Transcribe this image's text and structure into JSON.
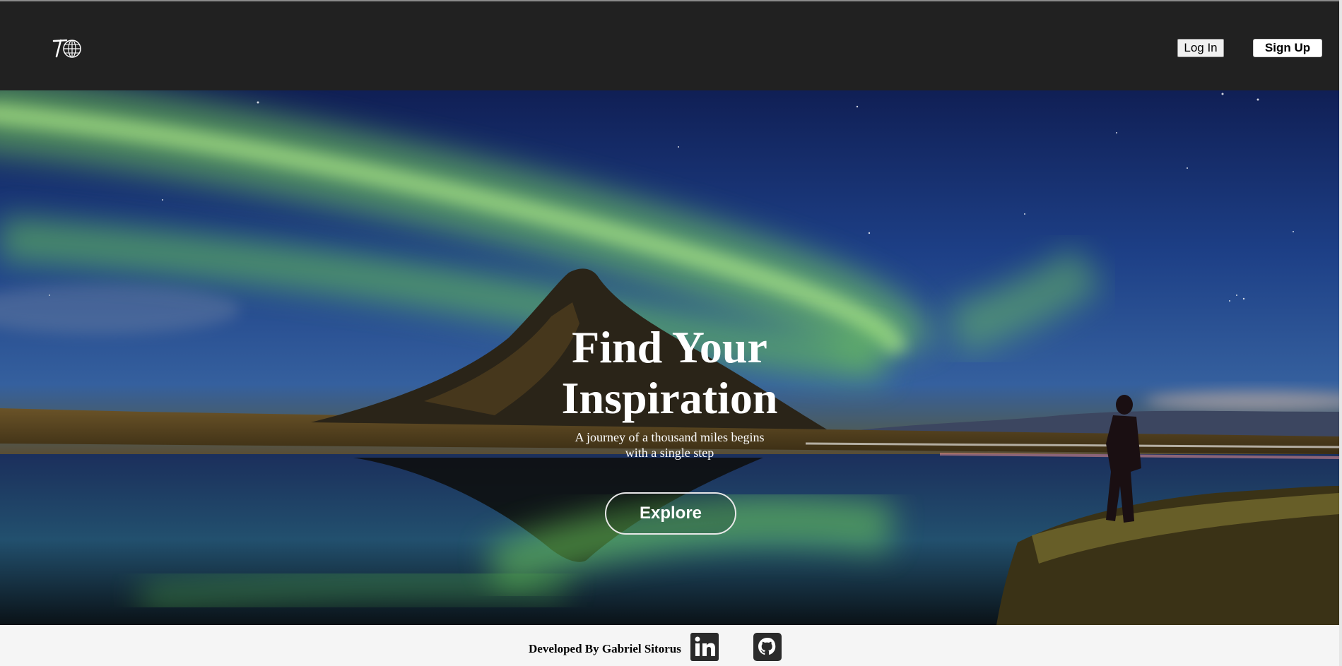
{
  "header": {
    "logo_icon": "travel-globe-logo-icon",
    "login_label": "Log In",
    "signup_label": "Sign Up"
  },
  "hero": {
    "background": "northern-lights-mountain-lake-photo",
    "title_line1": "Find Your",
    "title_line2": "Inspiration",
    "subtitle_line1": "A journey of a thousand miles begins",
    "subtitle_line2": "with a single step",
    "cta_label": "Explore"
  },
  "footer": {
    "credit": "Developed By Gabriel Sitorus",
    "social_icons": [
      "linkedin-icon",
      "github-icon"
    ]
  },
  "colors": {
    "navbar": "#212121",
    "footer": "#f5f5f5",
    "hero_text": "#ffffff"
  }
}
